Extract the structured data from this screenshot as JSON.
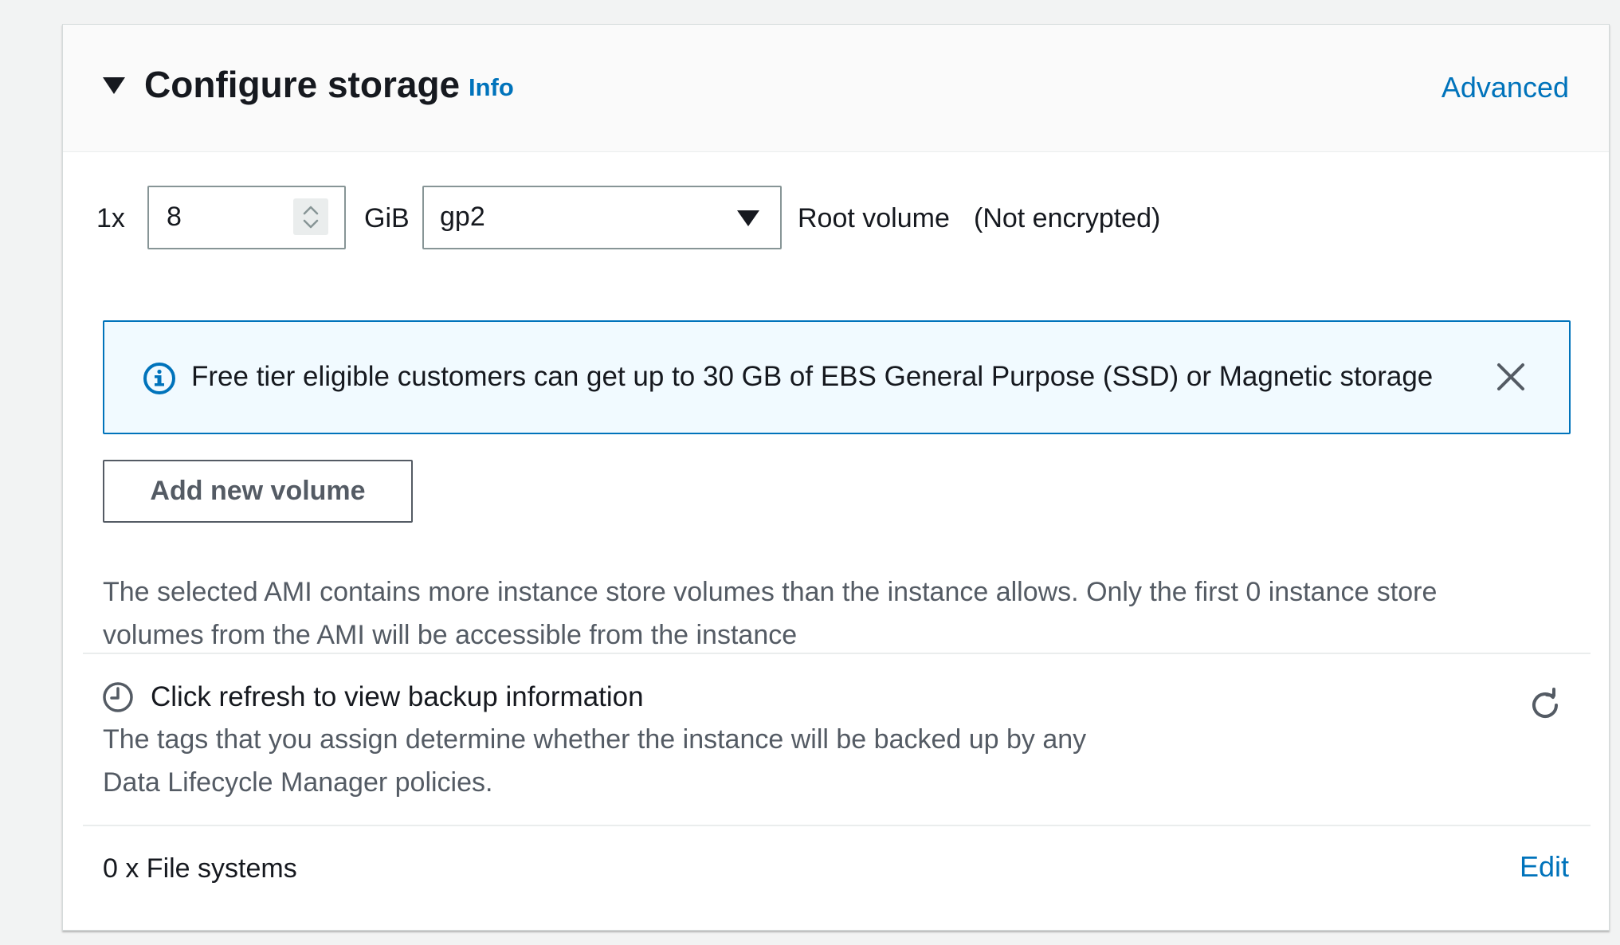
{
  "header": {
    "title": "Configure storage",
    "info_link": "Info",
    "advanced_link": "Advanced"
  },
  "volume": {
    "count_prefix": "1x",
    "size_value": "8",
    "size_unit": "GiB",
    "volume_type": "gp2",
    "root_label": "Root volume",
    "encryption": "(Not encrypted)"
  },
  "alert": {
    "message": "Free tier eligible customers can get up to 30 GB of EBS General Purpose (SSD) or Magnetic storage",
    "icon": "info-circle-icon",
    "close_icon": "close-icon"
  },
  "add_volume_button": "Add new volume",
  "ami_notice": {
    "line1": "The selected AMI contains more instance store volumes than the instance allows. Only the first 0 instance store",
    "line2": "volumes from the AMI will be accessible from the instance"
  },
  "backup": {
    "title": "Click refresh to view backup information",
    "line1": "The tags that you assign determine whether the instance will be backed up by any",
    "line2": "Data Lifecycle Manager policies.",
    "icon": "clock-icon",
    "refresh_icon": "refresh-icon"
  },
  "file_systems": {
    "label": "0 x File systems",
    "edit_link": "Edit"
  },
  "colors": {
    "link": "#0073bb",
    "alert_bg": "#f1faff",
    "alert_border": "#0073bb",
    "text_primary": "#16191f",
    "text_secondary": "#545b64"
  }
}
